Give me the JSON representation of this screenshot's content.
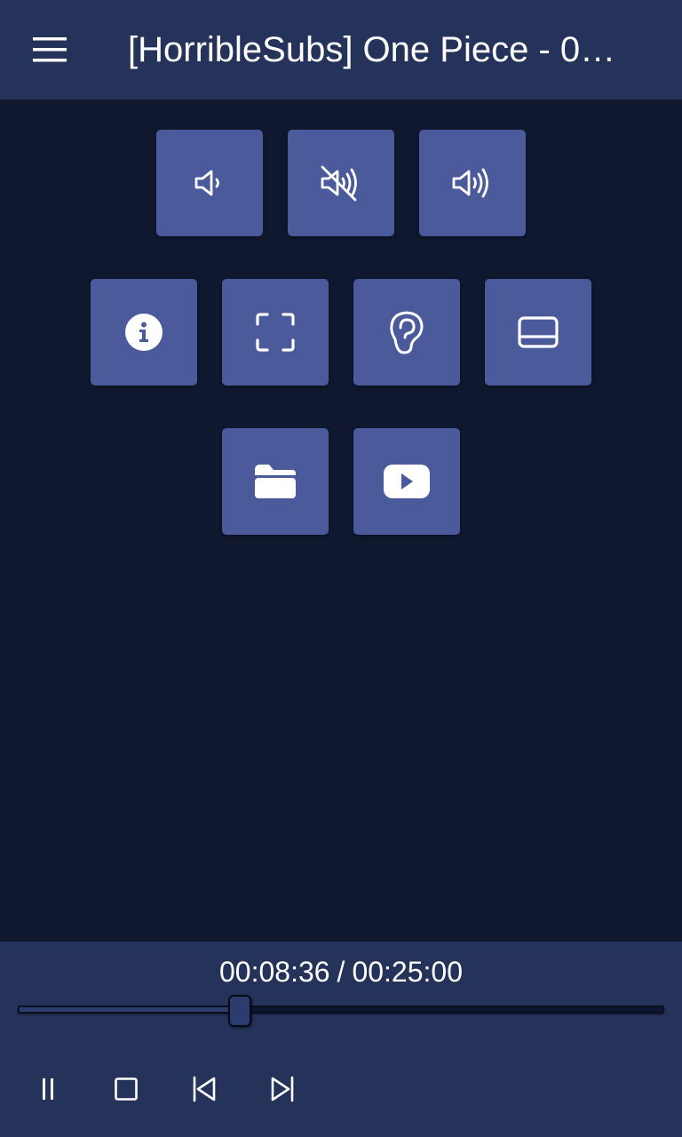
{
  "header": {
    "title": "[HorribleSubs] One Piece - 0…",
    "menu_icon": "hamburger-menu-icon"
  },
  "actions": {
    "row1": [
      {
        "icon": "volume-down-icon"
      },
      {
        "icon": "volume-mute-icon"
      },
      {
        "icon": "volume-up-icon"
      }
    ],
    "row2": [
      {
        "icon": "info-icon"
      },
      {
        "icon": "fullscreen-icon"
      },
      {
        "icon": "audio-track-icon"
      },
      {
        "icon": "subtitles-icon"
      }
    ],
    "row3": [
      {
        "icon": "open-folder-icon"
      },
      {
        "icon": "youtube-icon"
      }
    ]
  },
  "player": {
    "current_time": "00:08:36",
    "separator": "/",
    "total_time": "00:25:00",
    "progress": 0.344,
    "controls": [
      "pause-icon",
      "stop-icon",
      "skip-previous-icon",
      "skip-next-icon"
    ]
  },
  "colors": {
    "background": "#10182f",
    "bar": "#25325a",
    "tile": "#4a5a9b",
    "text": "#ffffff"
  }
}
